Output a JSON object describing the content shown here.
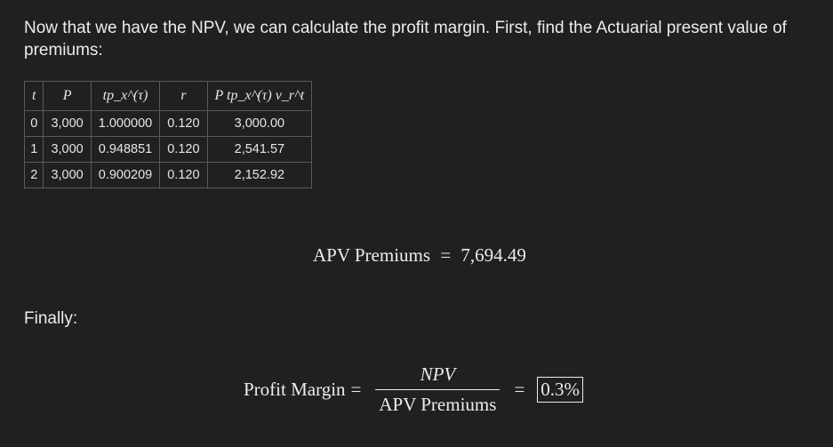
{
  "intro_text": "Now that we have the NPV, we can calculate the profit margin. First, find the Actuarial present value of premiums:",
  "table": {
    "columns": [
      "t",
      "P",
      "tp_x^(τ)",
      "r",
      "P tp_x^(τ) v_r^t"
    ],
    "rows": [
      [
        "0",
        "3,000",
        "1.000000",
        "0.120",
        "3,000.00"
      ],
      [
        "1",
        "3,000",
        "0.948851",
        "0.120",
        "2,541.57"
      ],
      [
        "2",
        "3,000",
        "0.900209",
        "0.120",
        "2,152.92"
      ]
    ]
  },
  "apv_equation": {
    "label": "APV Premiums",
    "equals": "=",
    "value": "7,694.49"
  },
  "finally_text": "Finally:",
  "profit_margin_equation": {
    "label": "Profit Margin",
    "equals": "=",
    "numerator": "NPV",
    "denominator": "APV Premiums",
    "result": "0.3%"
  }
}
